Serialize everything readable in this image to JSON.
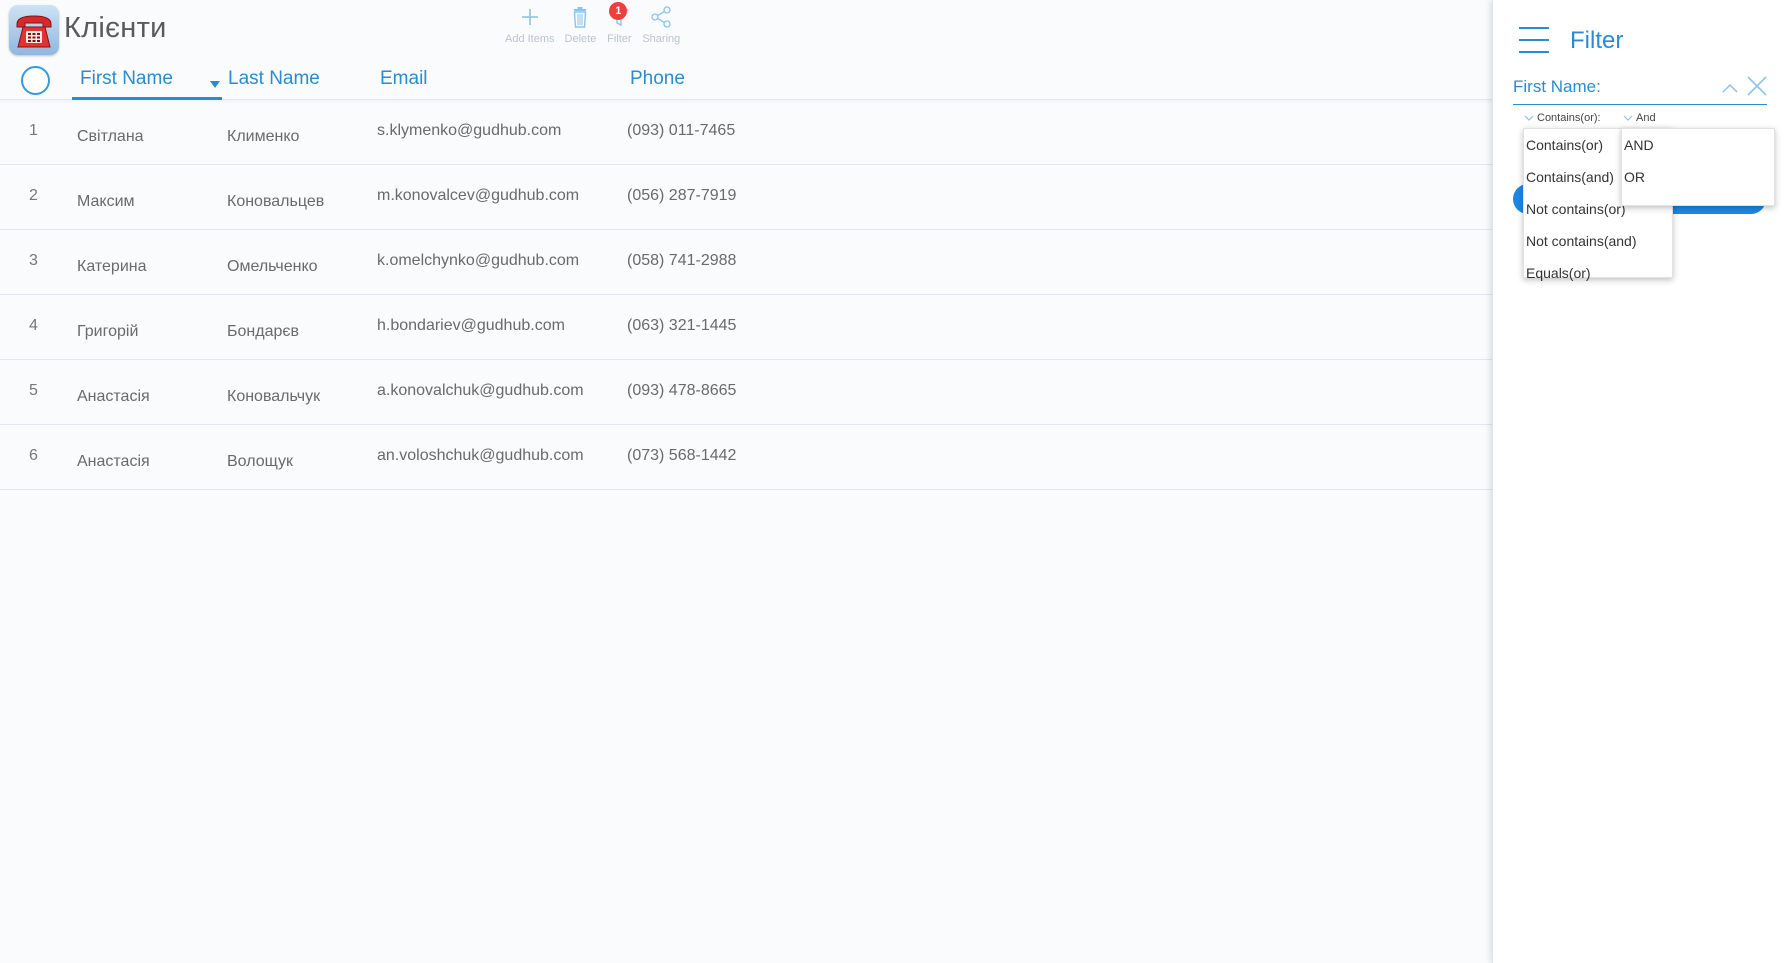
{
  "app": {
    "title": "Клієнти",
    "icon": "phone-app-icon"
  },
  "toolbar": {
    "add_label": "Add Items",
    "delete_label": "Delete",
    "filter_label": "Filter",
    "filter_badge": "1",
    "sharing_label": "Sharing"
  },
  "table": {
    "columns": {
      "first_name": "First Name",
      "last_name": "Last Name",
      "email": "Email",
      "phone": "Phone"
    },
    "rows": [
      {
        "num": "1",
        "first": "Світлана",
        "last": "Клименко",
        "email": "s.klymenko@gudhub.com",
        "phone": "(093) 011-7465"
      },
      {
        "num": "2",
        "first": "Максим",
        "last": "Коновальцев",
        "email": "m.konovalcev@gudhub.com",
        "phone": "(056) 287-7919"
      },
      {
        "num": "3",
        "first": "Катерина",
        "last": "Омельченко",
        "email": "k.omelchynko@gudhub.com",
        "phone": "(058) 741-2988"
      },
      {
        "num": "4",
        "first": "Григорій",
        "last": "Бондарєв",
        "email": "h.bondariev@gudhub.com",
        "phone": "(063) 321-1445"
      },
      {
        "num": "5",
        "first": "Анастасія",
        "last": "Коновальчук",
        "email": "a.konovalchuk@gudhub.com",
        "phone": "(093) 478-8665"
      },
      {
        "num": "6",
        "first": "Анастасія",
        "last": "Волощук",
        "email": "an.voloshchuk@gudhub.com",
        "phone": "(073) 568-1442"
      }
    ]
  },
  "filter_panel": {
    "title": "Filter",
    "field_label": "First Name:",
    "condition_selected": "Contains(or):",
    "join_selected": "And",
    "condition_options": [
      "Contains(or)",
      "Contains(and)",
      "Not contains(or)",
      "Not contains(and)",
      "Equals(or)"
    ],
    "join_options": [
      "AND",
      "OR"
    ]
  },
  "colors": {
    "accent": "#2a8cd0",
    "badge": "#ef3e3e",
    "apply_button": "#1e88e5"
  }
}
